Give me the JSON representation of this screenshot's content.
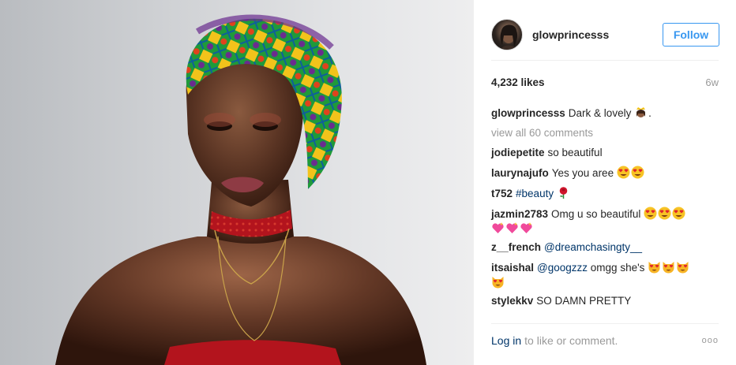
{
  "author": {
    "username": "glowprincesss",
    "follow_label": "Follow"
  },
  "stats": {
    "likes": "4,232 likes",
    "age": "6w"
  },
  "caption": {
    "username": "glowprincesss",
    "text": "Dark & lovely",
    "emoji": [
      "crown-woman"
    ],
    "suffix": "."
  },
  "view_all": "view all 60 comments",
  "comments": [
    {
      "username": "jodiepetite",
      "text": "so beautiful",
      "emoji": []
    },
    {
      "username": "laurynajufo",
      "text": "Yes you aree",
      "emoji": [
        "heart-eyes",
        "heart-eyes"
      ]
    },
    {
      "username": "t752",
      "tag": "#beauty",
      "emoji": [
        "rose"
      ]
    },
    {
      "username": "jazmin2783",
      "text": "Omg u so beautiful",
      "emoji": [
        "heart-eyes",
        "heart-eyes",
        "heart-eyes",
        "sparkling-heart",
        "sparkling-heart",
        "sparkling-heart"
      ]
    },
    {
      "username": "z__french",
      "tag": "@dreamchasingty__",
      "emoji": []
    },
    {
      "username": "itsaishal",
      "tag": "@googzzz",
      "text": "omgg she's",
      "emoji": [
        "heart-eyes-cat",
        "heart-eyes-cat",
        "heart-eyes-cat",
        "heart-eyes-cat"
      ]
    },
    {
      "username": "stylekkv",
      "text": "SO DAMN PRETTY",
      "emoji": []
    }
  ],
  "footer": {
    "login_label": "Log in",
    "prompt": "to like or comment.",
    "more_label": "ooo"
  },
  "colors": {
    "link_blue": "#3897f0",
    "tag_blue": "#003569",
    "muted": "#999999",
    "text": "#262626"
  }
}
